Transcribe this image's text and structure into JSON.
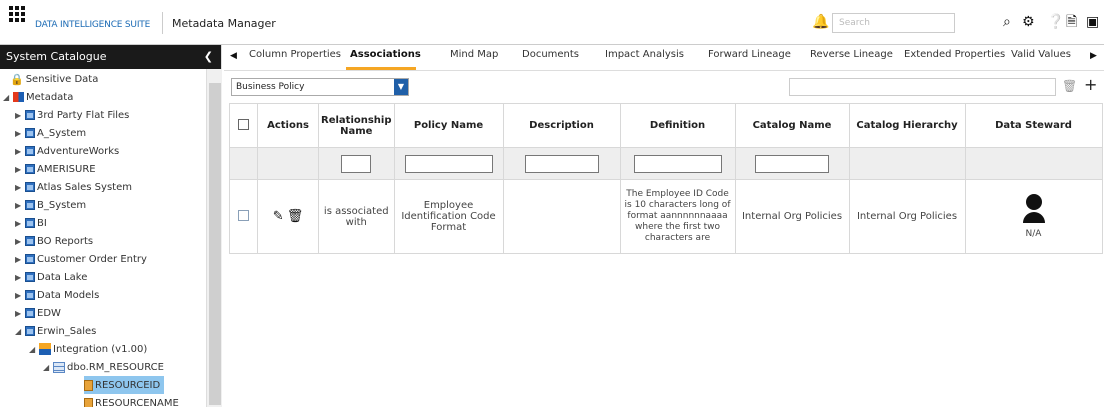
{
  "app": {
    "brand": "DATA INTELLIGENCE SUITE",
    "module": "Metadata Manager",
    "search_placeholder": "Search"
  },
  "sidebar": {
    "title": "System Catalogue",
    "items": [
      {
        "label": "Sensitive Data"
      },
      {
        "label": "Metadata"
      },
      {
        "label": "3rd Party Flat Files"
      },
      {
        "label": "A_System"
      },
      {
        "label": "AdventureWorks"
      },
      {
        "label": "AMERISURE"
      },
      {
        "label": "Atlas Sales System"
      },
      {
        "label": "B_System"
      },
      {
        "label": "BI"
      },
      {
        "label": "BO Reports"
      },
      {
        "label": "Customer Order Entry"
      },
      {
        "label": "Data Lake"
      },
      {
        "label": "Data Models"
      },
      {
        "label": "EDW"
      },
      {
        "label": "Erwin_Sales"
      },
      {
        "label": "Integration (v1.00)"
      },
      {
        "label": "dbo.RM_RESOURCE"
      },
      {
        "label": "RESOURCEID"
      },
      {
        "label": "RESOURCENAME"
      }
    ]
  },
  "tabs": [
    {
      "label": "Column Properties"
    },
    {
      "label": "Associations"
    },
    {
      "label": "Mind Map"
    },
    {
      "label": "Documents"
    },
    {
      "label": "Impact Analysis"
    },
    {
      "label": "Forward Lineage"
    },
    {
      "label": "Reverse Lineage"
    },
    {
      "label": "Extended Properties"
    },
    {
      "label": "Valid Values"
    }
  ],
  "filter": {
    "selected": "Business Policy"
  },
  "table": {
    "headers": [
      "Actions",
      "Relationship Name",
      "Policy Name",
      "Description",
      "Definition",
      "Catalog Name",
      "Catalog Hierarchy",
      "Data Steward"
    ],
    "rows": [
      {
        "relationship": "is associated with",
        "policy_name": "Employee Identification Code Format",
        "description": "",
        "definition": "The Employee ID Code is 10 characters long of format aannnnnnaaaa where the first two characters are",
        "catalog_name": "Internal Org Policies",
        "catalog_hierarchy": "Internal Org Policies",
        "data_steward": "N/A"
      }
    ]
  }
}
